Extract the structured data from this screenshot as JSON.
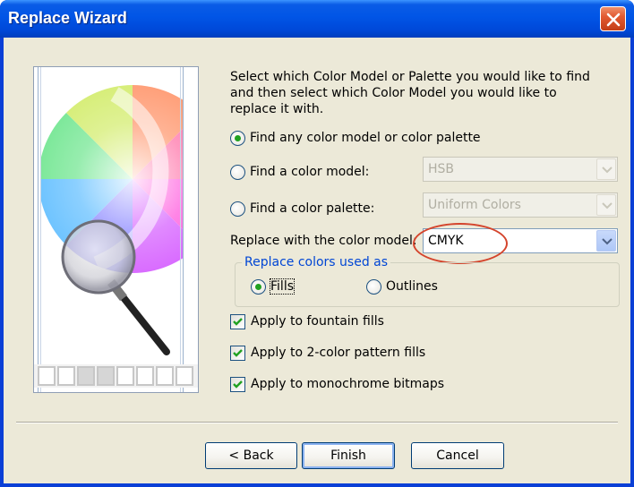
{
  "window": {
    "title": "Replace Wizard"
  },
  "instructions": "Select which Color Model or Palette you would like to find and then select which Color Model you would like to replace it with.",
  "options": {
    "find_any": {
      "label": "Find any color model or color palette",
      "selected": true
    },
    "find_model": {
      "label": "Find a color model:",
      "selected": false,
      "value": "HSB"
    },
    "find_palette": {
      "label": "Find a color palette:",
      "selected": false,
      "value": "Uniform Colors"
    }
  },
  "replace_model": {
    "label": "Replace with the color model:",
    "value": "CMYK"
  },
  "replace_group": {
    "legend": "Replace colors used as",
    "fills": {
      "label": "Fills",
      "selected": true
    },
    "outlines": {
      "label": "Outlines",
      "selected": false
    }
  },
  "checks": [
    {
      "label": "Apply to fountain fills",
      "checked": true
    },
    {
      "label": "Apply to 2-color pattern fills",
      "checked": true
    },
    {
      "label": "Apply to monochrome bitmaps",
      "checked": true
    }
  ],
  "buttons": {
    "back": "< Back",
    "finish": "Finish",
    "cancel": "Cancel"
  },
  "colors": {
    "title_bar": "#0055e5",
    "client": "#ece9d8",
    "annotation": "#d4442c",
    "group_legend": "#0046d5"
  },
  "icons": {
    "close": "close-icon",
    "dropdown": "chevron-down-icon",
    "illustration": "magnifier-color-wheel"
  }
}
